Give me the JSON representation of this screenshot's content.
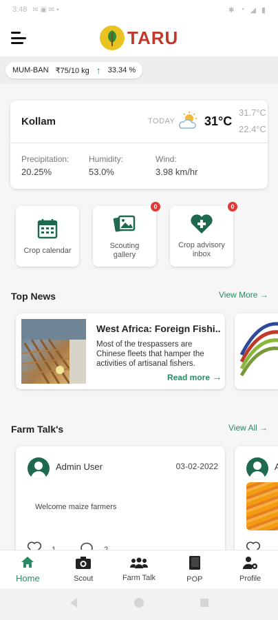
{
  "status_bar": {
    "time": "3:48"
  },
  "header": {
    "brand": "TARU"
  },
  "ticker": {
    "market": "MUM-BAN",
    "price": "₹75/10 kg",
    "change": "33.34 %"
  },
  "weather": {
    "city": "Kollam",
    "today_label": "TODAY",
    "temp": "31°C",
    "high": "31.7°C",
    "low": "22.4°C",
    "precipitation_label": "Precipitation:",
    "precipitation": "20.25%",
    "humidity_label": "Humidity:",
    "humidity": "53.0%",
    "wind_label": "Wind:",
    "wind": "3.98 km/hr"
  },
  "tiles": [
    {
      "label": "Crop calendar",
      "badge": ""
    },
    {
      "label": "Scouting gallery",
      "badge": "0"
    },
    {
      "label": "Crop advisory inbox",
      "badge": "0"
    }
  ],
  "top_news": {
    "title": "Top News",
    "view_more": "View More",
    "items": [
      {
        "title": "West Africa: Foreign Fishi...",
        "snippet": "Most of the trespassers are Chinese fleets that hamper the activities of artisanal fishers.",
        "read_more": "Read more"
      }
    ]
  },
  "farm_talk": {
    "title": "Farm Talk's",
    "view_all": "View All",
    "posts": [
      {
        "user": "Admin User",
        "date": "03-02-2022",
        "message": "Welcome maize farmers",
        "likes": "1",
        "comments": "2"
      }
    ],
    "peek_initial": "A"
  },
  "bottom_nav": [
    {
      "label": "Home",
      "active": true
    },
    {
      "label": "Scout",
      "active": false
    },
    {
      "label": "Farm Talk",
      "active": false
    },
    {
      "label": "POP",
      "active": false
    },
    {
      "label": "Profile",
      "active": false
    }
  ],
  "colors": {
    "accent": "#2a8a63",
    "brand_red": "#c0392b",
    "brand_yellow": "#e8c321",
    "badge": "#e0383a"
  },
  "icons": [
    "menu-icon",
    "sun-cloud-icon",
    "calendar-icon",
    "gallery-icon",
    "heart-plus-icon",
    "arrow-up-icon",
    "arrow-right-icon",
    "heart-icon",
    "comment-icon",
    "home-icon",
    "camera-icon",
    "group-icon",
    "book-icon",
    "profile-gear-icon"
  ]
}
